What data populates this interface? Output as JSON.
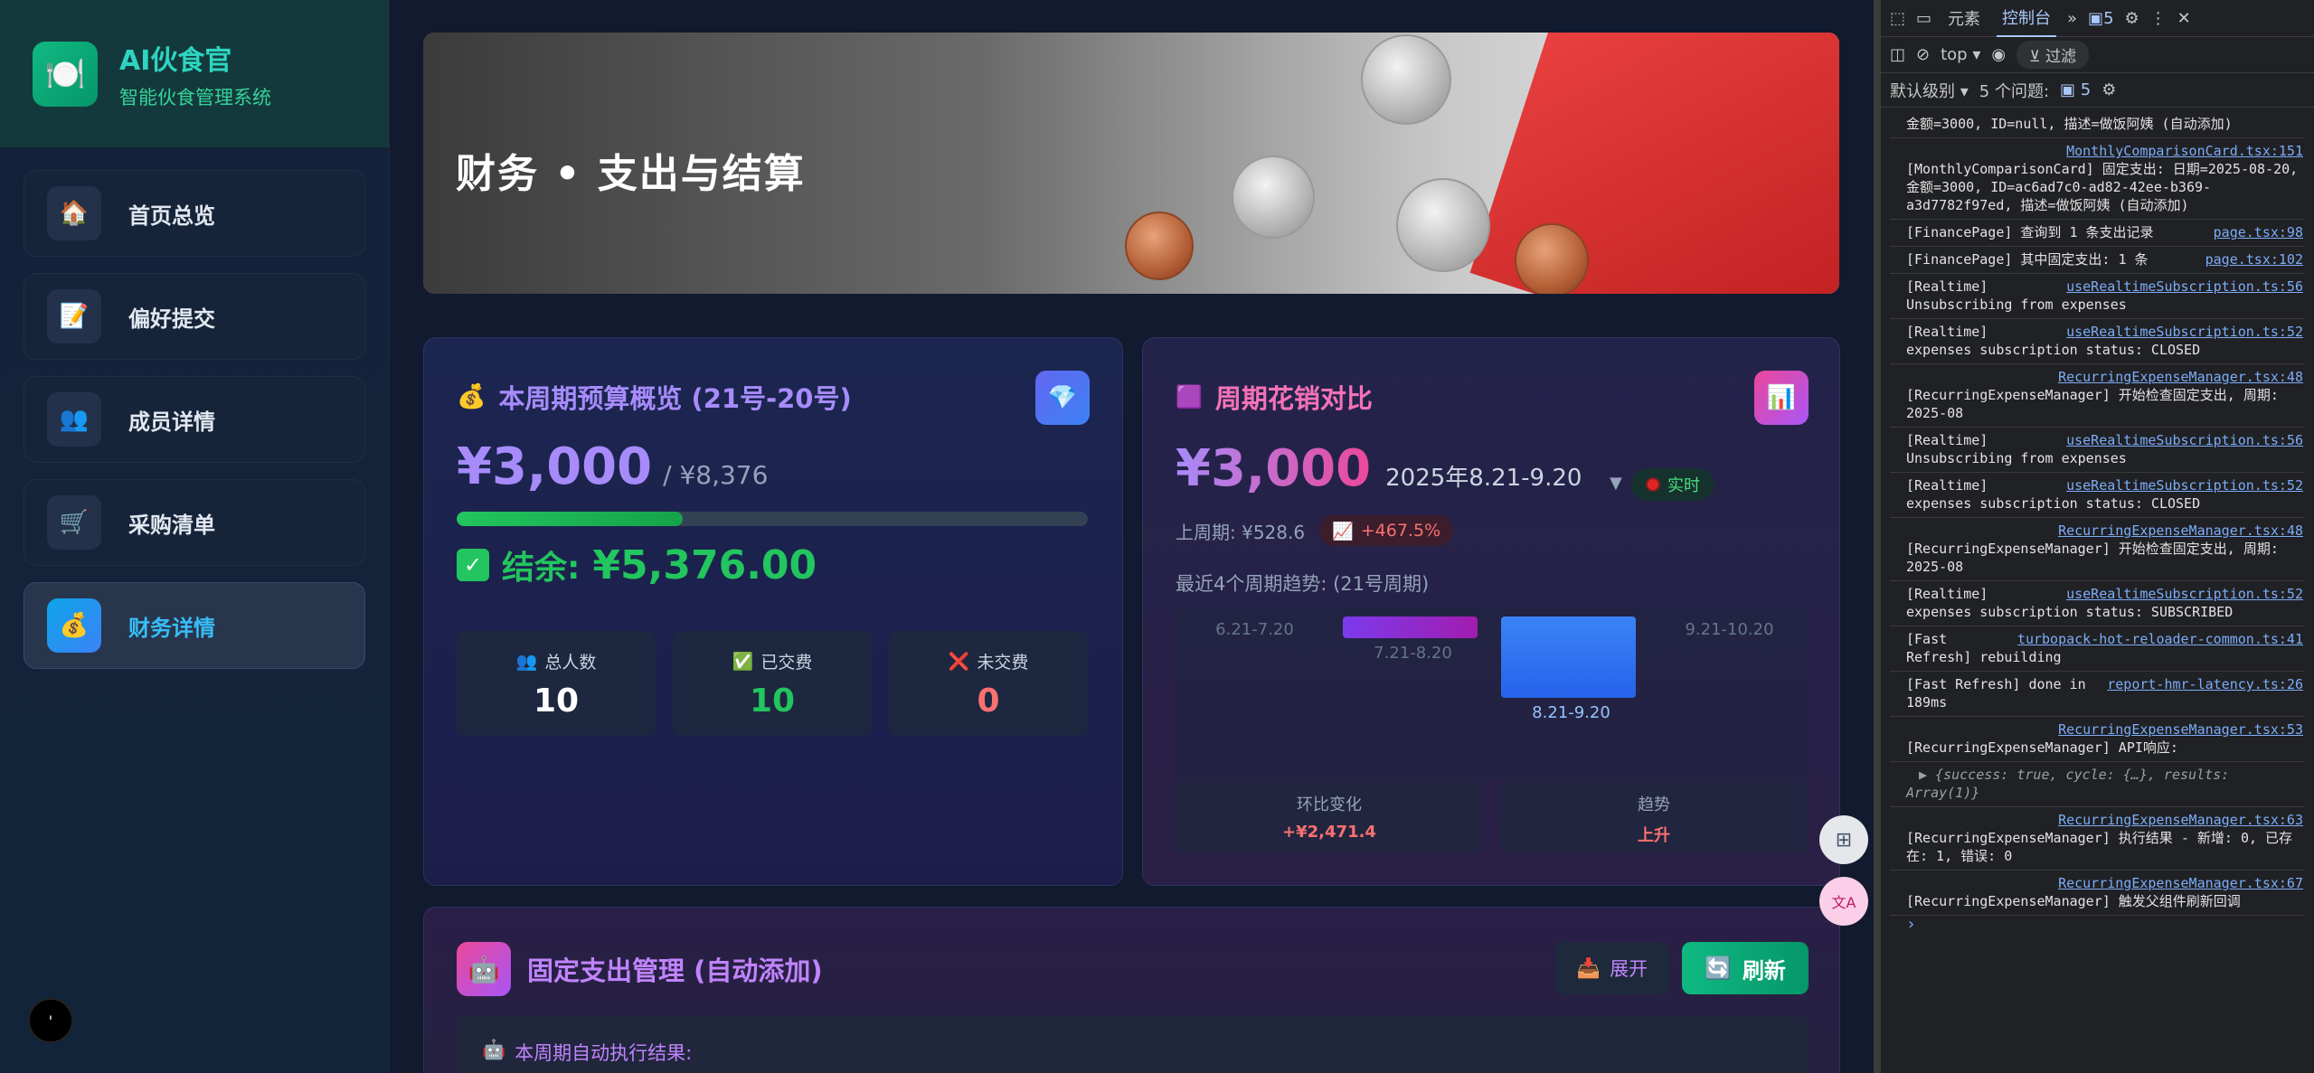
{
  "brand": {
    "logo_icon": "🍽️",
    "title": "AI伙食官",
    "subtitle": "智能伙食管理系统"
  },
  "nav": [
    {
      "icon": "🏠",
      "label": "首页总览",
      "active": false
    },
    {
      "icon": "📝",
      "label": "偏好提交",
      "active": false
    },
    {
      "icon": "👥",
      "label": "成员详情",
      "active": false
    },
    {
      "icon": "🛒",
      "label": "采购清单",
      "active": false
    },
    {
      "icon": "💰",
      "label": "财务详情",
      "active": true
    }
  ],
  "hero": {
    "title": "财务 • 支出与结算"
  },
  "budget": {
    "icon": "💰",
    "title": "本周期预算概览 (21号-20号)",
    "badge_icon": "💎",
    "spent": "¥3,000",
    "total": "/ ¥8,376",
    "progress": 0.358,
    "remain_label": "结余:",
    "remain_value": "¥5,376.00",
    "stats": [
      {
        "icon": "👥",
        "label": "总人数",
        "value": "10",
        "color": "#ffffff"
      },
      {
        "icon": "✅",
        "label": "已交费",
        "value": "10",
        "color": "#22c55e"
      },
      {
        "icon": "❌",
        "label": "未交费",
        "value": "0",
        "color": "#f87171"
      }
    ]
  },
  "compare": {
    "icon": "🟪",
    "title": "周期花销对比",
    "badge_icon": "📊",
    "amount": "¥3,000",
    "range": "2025年8.21-9.20",
    "dropdown": "▼",
    "live_label": "实时",
    "prev_label": "上周期: ¥528.6",
    "pct_icon": "📈",
    "pct": "+467.5%",
    "trend_title": "最近4个周期趋势: (21号周期)",
    "mini": [
      {
        "label": "环比变化",
        "value": "+¥2,471.4"
      },
      {
        "label": "趋势",
        "value": "上升"
      }
    ]
  },
  "chart_data": {
    "type": "bar",
    "categories": [
      "6.21-7.20",
      "7.21-8.20",
      "8.21-9.20",
      "9.21-10.20"
    ],
    "values": [
      0,
      528.6,
      3000,
      0
    ],
    "current_index": 2,
    "colors": [
      "#7c3aed",
      "#a21caf",
      "#3b82f6",
      "#3b82f6"
    ]
  },
  "fixed": {
    "icon": "🤖",
    "title": "固定支出管理 (自动添加)",
    "expand_icon": "📥",
    "expand_label": "展开",
    "refresh_icon": "🔄",
    "refresh_label": "刷新",
    "exec_icon": "🤖",
    "exec_label": "本周期自动执行结果:"
  },
  "devtools": {
    "tabs": [
      "元素",
      "控制台"
    ],
    "active_tab": "控制台",
    "issues_badge": "5",
    "context": "top",
    "filter_placeholder": "过滤",
    "level": "默认级别",
    "issues_label": "5 个问题:",
    "issues_count": "5",
    "messages": [
      {
        "text": "金额=3000, ID=null, 描述=做饭阿姨 (自动添加)",
        "src": ""
      },
      {
        "text": "[MonthlyComparisonCard] 固定支出: 日期=2025-08-20, 金额=3000, ID=ac6ad7c0-ad82-42ee-b369-a3d7782f97ed, 描述=做饭阿姨 (自动添加)",
        "src": "MonthlyComparisonCard.tsx:151"
      },
      {
        "text": "[FinancePage] 查询到 1 条支出记录",
        "src": "page.tsx:98"
      },
      {
        "text": "[FinancePage] 其中固定支出: 1 条",
        "src": "page.tsx:102"
      },
      {
        "text": "[Realtime] Unsubscribing from expenses",
        "src": "useRealtimeSubscription.ts:56"
      },
      {
        "text": "[Realtime] expenses subscription status: CLOSED",
        "src": "useRealtimeSubscription.ts:52"
      },
      {
        "text": "[RecurringExpenseManager] 开始检查固定支出, 周期: 2025-08",
        "src": "RecurringExpenseManager.tsx:48"
      },
      {
        "text": "[Realtime] Unsubscribing from expenses",
        "src": "useRealtimeSubscription.ts:56"
      },
      {
        "text": "[Realtime] expenses subscription status: CLOSED",
        "src": "useRealtimeSubscription.ts:52"
      },
      {
        "text": "[RecurringExpenseManager] 开始检查固定支出, 周期: 2025-08",
        "src": "RecurringExpenseManager.tsx:48"
      },
      {
        "text": "[Realtime] expenses subscription status: SUBSCRIBED",
        "src": "useRealtimeSubscription.ts:52"
      },
      {
        "text": "[Fast Refresh] rebuilding",
        "src": "turbopack-hot-reloader-common.ts:41"
      },
      {
        "text": "[Fast Refresh] done in 189ms",
        "src": "report-hmr-latency.ts:26"
      },
      {
        "text": "[RecurringExpenseManager] API响应:",
        "src": "RecurringExpenseManager.tsx:53"
      },
      {
        "text": "▶ {success: true, cycle: {…}, results: Array(1)}",
        "src": "",
        "obj": true
      },
      {
        "text": "[RecurringExpenseManager] 执行结果 - 新增: 0, 已存在: 1, 错误: 0",
        "src": "RecurringExpenseManager.tsx:63"
      },
      {
        "text": "[RecurringExpenseManager] 触发父组件刷新回调",
        "src": "RecurringExpenseManager.tsx:67"
      }
    ],
    "prompt": "›"
  }
}
